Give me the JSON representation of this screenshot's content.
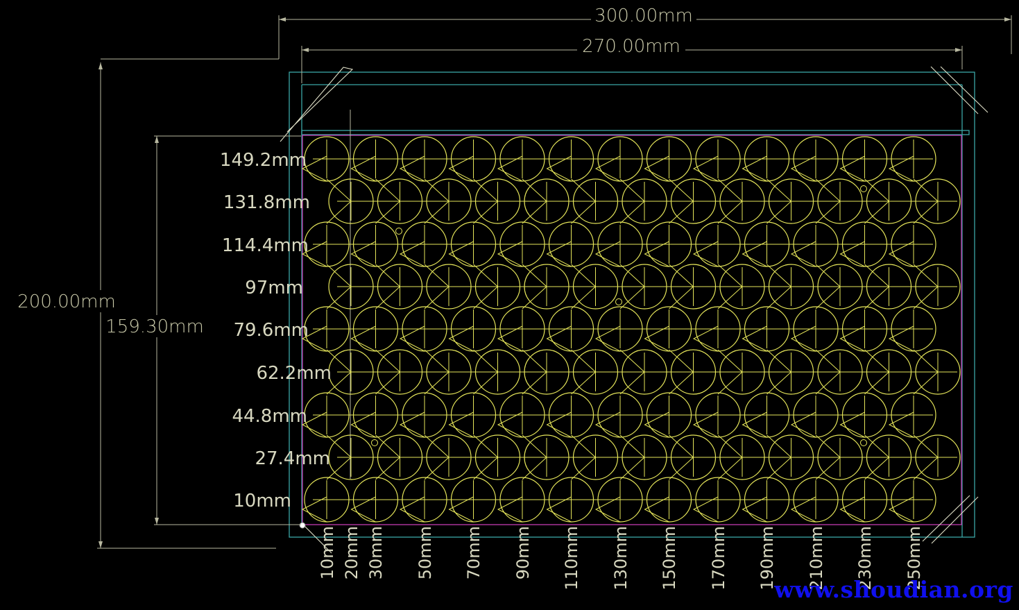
{
  "dimensions": {
    "outer_width": "300.00mm",
    "inner_width": "270.00mm",
    "outer_height": "200.00mm",
    "inner_height": "159.30mm"
  },
  "row_labels": [
    "149.2mm",
    "131.8mm",
    "114.4mm",
    "97mm",
    "79.6mm",
    "62.2mm",
    "44.8mm",
    "27.4mm",
    "10mm"
  ],
  "column_labels": [
    "10mm",
    "20mm",
    "30mm",
    "50mm",
    "70mm",
    "90mm",
    "110mm",
    "130mm",
    "150mm",
    "170mm",
    "190mm",
    "210mm",
    "230mm",
    "250mm"
  ],
  "watermark": "www.shoudian.org",
  "colors": {
    "background": "#000000",
    "cells": "#e6e65a",
    "board_outline": "#3aa6a6",
    "keepout": "#c23bb0",
    "dimension_lines": "#b8b8a0",
    "watermark": "#1010ee"
  },
  "grid": {
    "rows": 9,
    "odd_row_count": 13,
    "even_row_count": 13
  }
}
